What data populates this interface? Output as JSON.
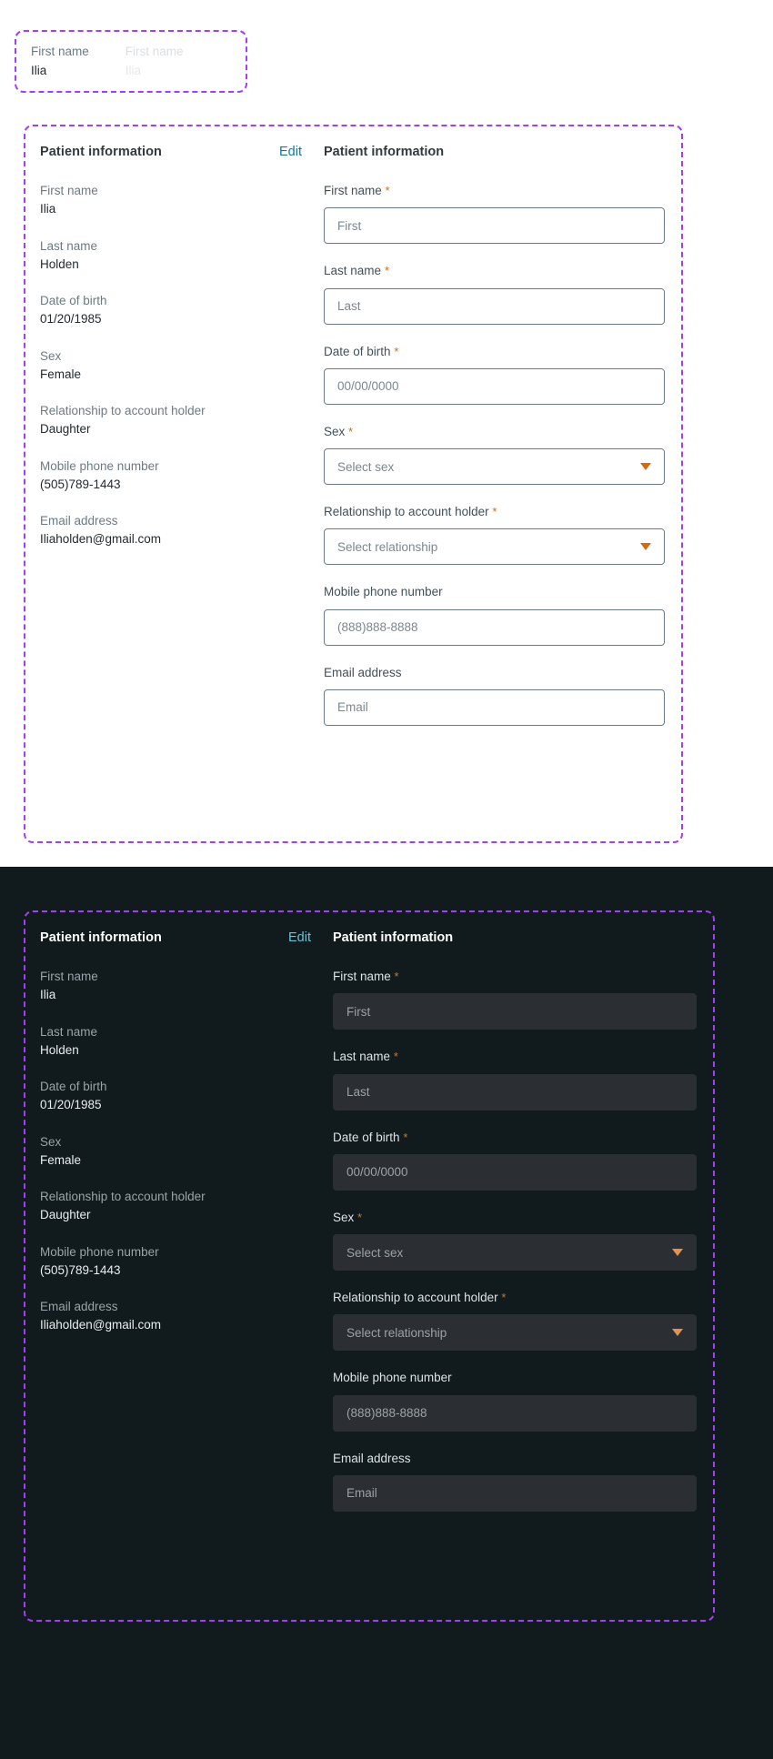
{
  "snippet": {
    "label": "First name",
    "value": "Ilia",
    "ghost_label": "First name",
    "ghost_value": "Ilia"
  },
  "colors": {
    "accent_link_light": "#0f7b9c",
    "accent_link_dark": "#67c3d8",
    "required_asterisk": "#d4690f",
    "dropdown_caret": "#d4690f",
    "annotation_dash": "#a43df5",
    "dark_background": "#111a1d",
    "dark_input_fill": "#2b2f34",
    "light_background": "#ffffff"
  },
  "card": {
    "summary_title": "Patient information",
    "edit_label": "Edit",
    "form_title": "Patient information",
    "asterisk": "*",
    "summary_fields": [
      {
        "label": "First name",
        "value": "Ilia"
      },
      {
        "label": "Last name",
        "value": "Holden"
      },
      {
        "label": "Date of birth",
        "value": "01/20/1985"
      },
      {
        "label": "Sex",
        "value": "Female"
      },
      {
        "label": "Relationship to account holder",
        "value": "Daughter"
      },
      {
        "label": "Mobile phone number",
        "value": "(505)789-1443"
      },
      {
        "label": "Email address",
        "value": "Iliaholden@gmail.com"
      }
    ],
    "form_fields": [
      {
        "label": "First name",
        "required": true,
        "type": "text",
        "placeholder": "First",
        "value": ""
      },
      {
        "label": "Last name",
        "required": true,
        "type": "text",
        "placeholder": "Last",
        "value": ""
      },
      {
        "label": "Date of birth",
        "required": true,
        "type": "text",
        "placeholder": "00/00/0000",
        "value": ""
      },
      {
        "label": "Sex",
        "required": true,
        "type": "select",
        "placeholder": "Select sex",
        "value": ""
      },
      {
        "label": "Relationship to account holder",
        "required": true,
        "type": "select",
        "placeholder": "Select relationship",
        "value": ""
      },
      {
        "label": "Mobile phone number",
        "required": false,
        "type": "text",
        "placeholder": "(888)888-8888",
        "value": ""
      },
      {
        "label": "Email address",
        "required": false,
        "type": "text",
        "placeholder": "Email",
        "value": ""
      }
    ]
  }
}
